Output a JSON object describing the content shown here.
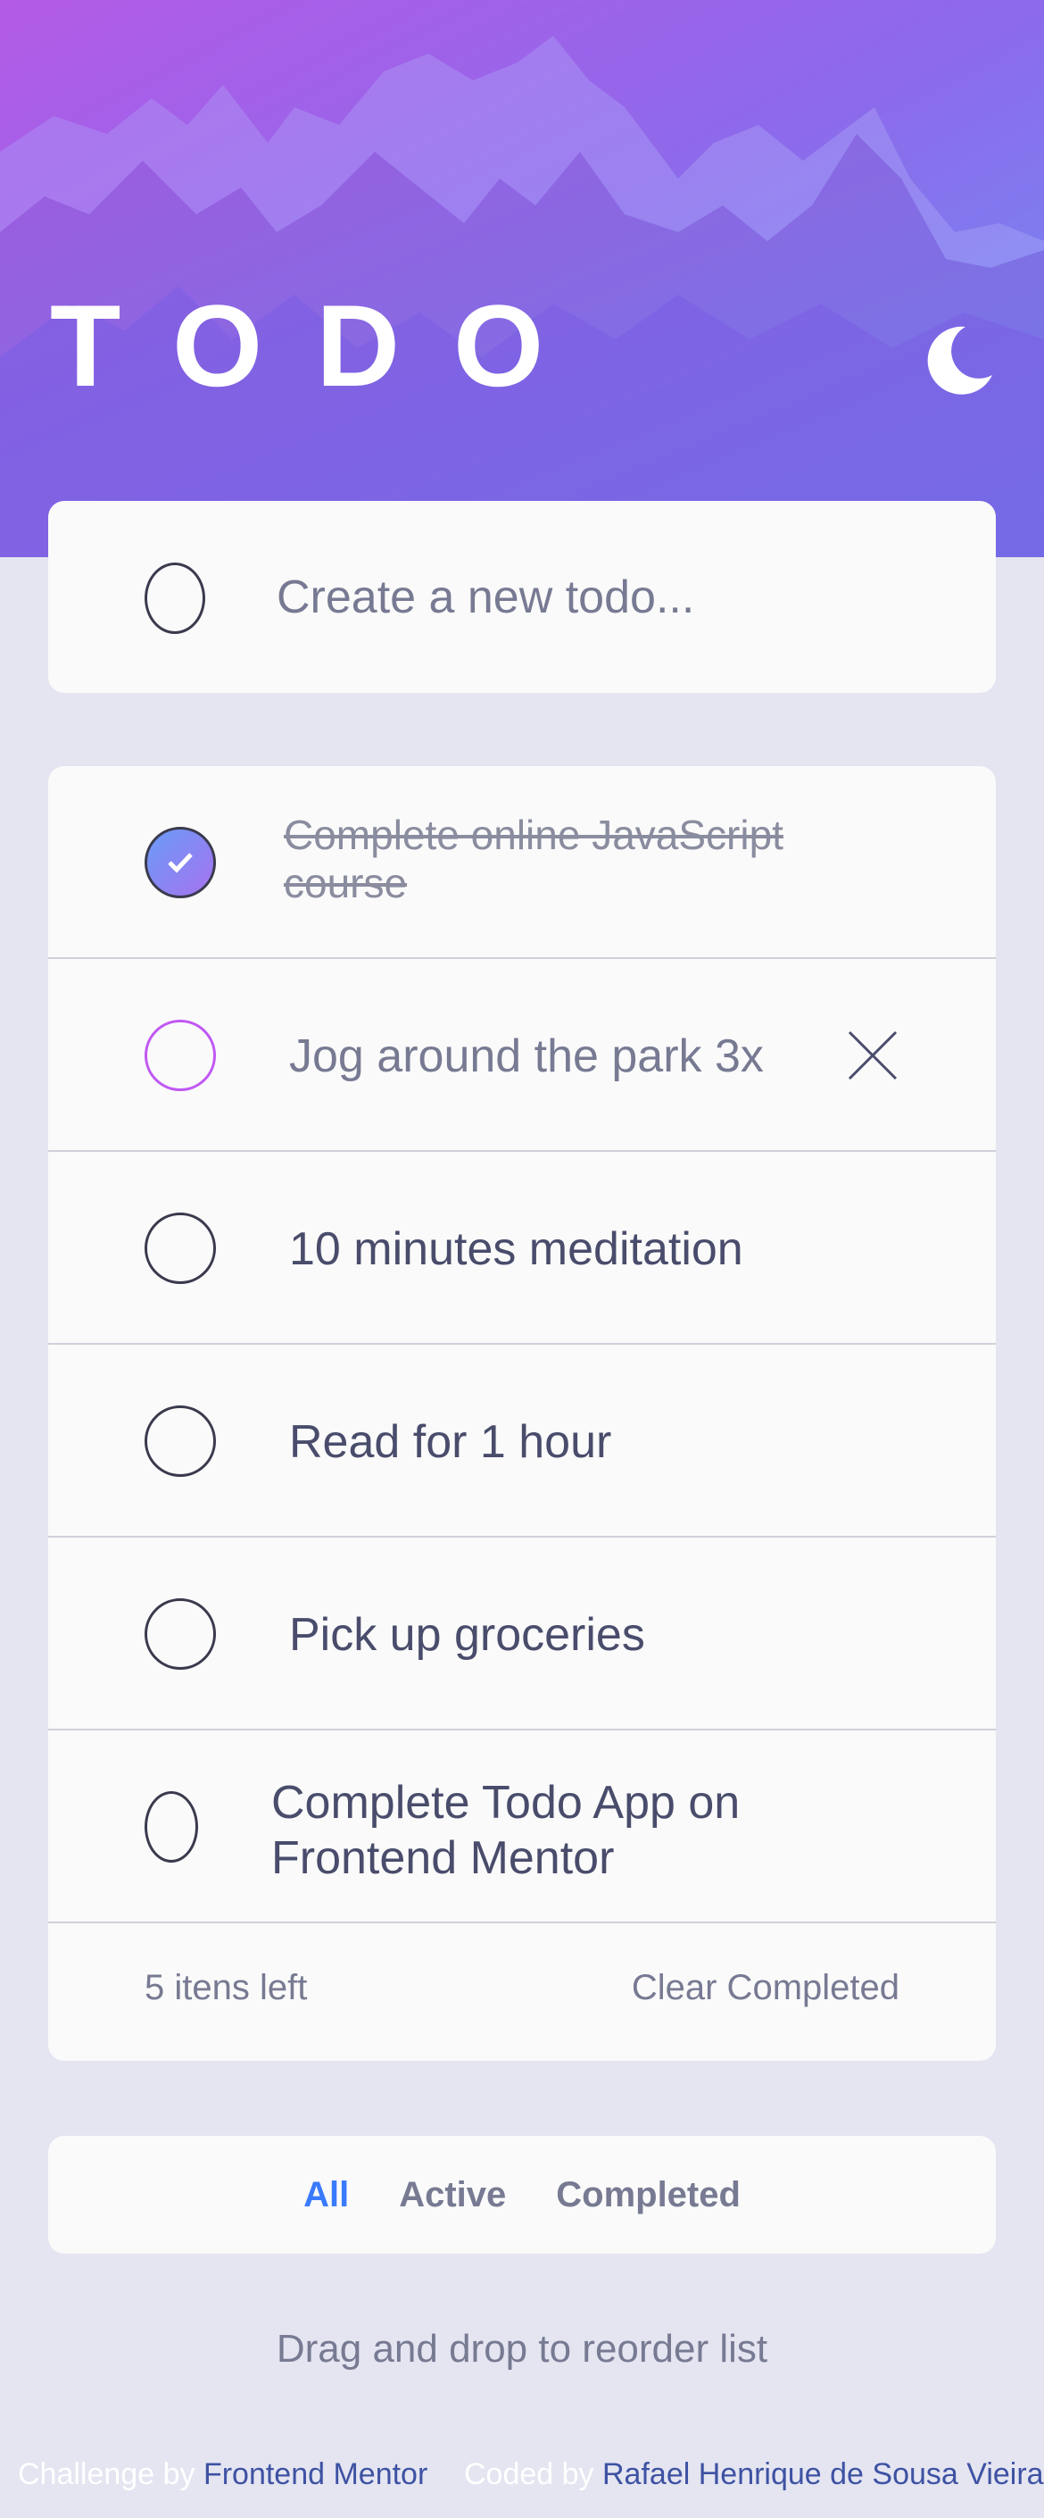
{
  "header": {
    "title": "TODO",
    "theme_toggle_icon": "moon-icon"
  },
  "new_todo": {
    "placeholder": "Create a new todo..."
  },
  "todos": [
    {
      "text": "Complete online JavaScript course",
      "completed": true
    },
    {
      "text": "Jog around the park 3x",
      "completed": false,
      "hovered": true
    },
    {
      "text": "10 minutes meditation",
      "completed": false
    },
    {
      "text": "Read for 1 hour",
      "completed": false
    },
    {
      "text": "Pick up groceries",
      "completed": false
    },
    {
      "text": "Complete Todo App on Frontend Mentor",
      "completed": false
    }
  ],
  "list_footer": {
    "items_left": "5 itens left",
    "clear_completed": "Clear Completed"
  },
  "filters": {
    "all": "All",
    "active": "Active",
    "completed": "Completed",
    "selected": "All"
  },
  "drag_hint": "Drag and drop to reorder list",
  "attribution": {
    "challenge_prefix": "Challenge by",
    "challenge_link": "Frontend Mentor",
    "coded_prefix": "Coded by",
    "coded_link": "Rafael Henrique de Sousa Vieira"
  },
  "colors": {
    "accent": "#3a7bfd",
    "check_gradient_start": "#57ddff",
    "check_gradient_end": "#c058f3",
    "page_background": "#e4e5f1",
    "card_background": "#fafafa"
  }
}
